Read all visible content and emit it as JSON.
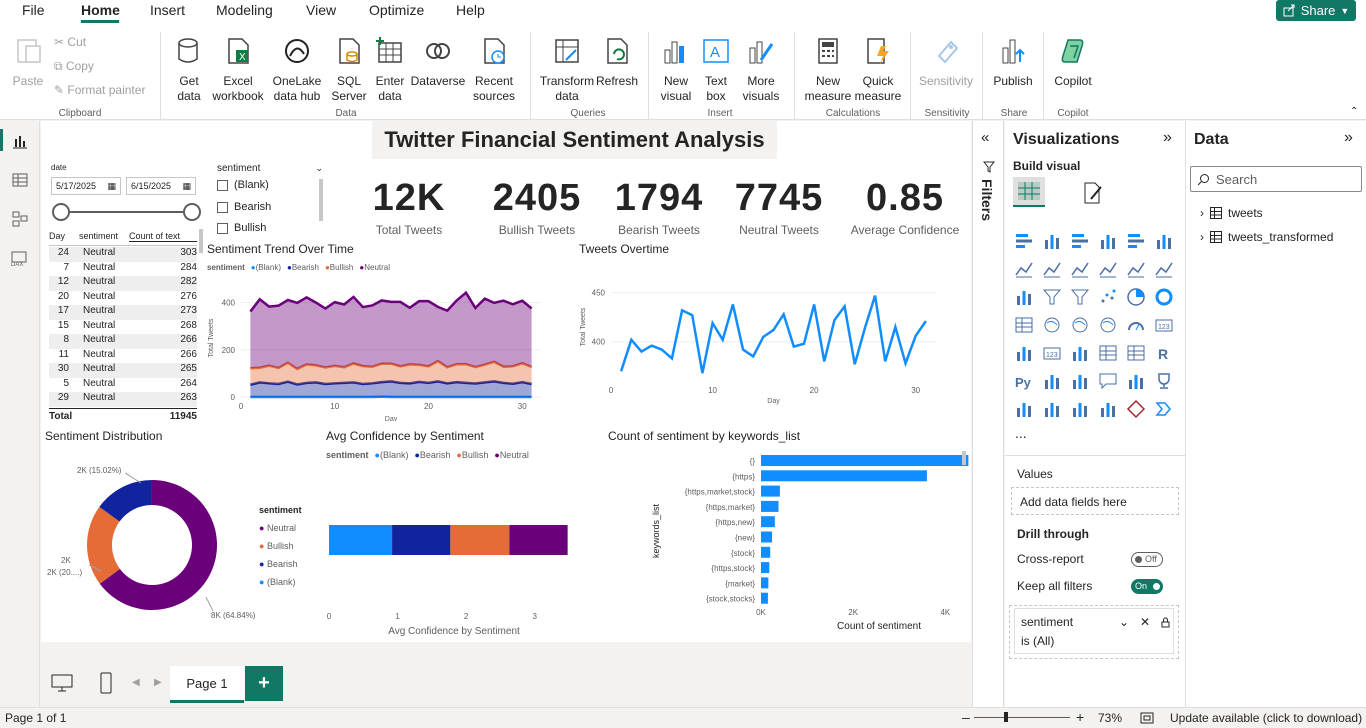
{
  "menu": {
    "items": [
      "File",
      "Home",
      "Insert",
      "Modeling",
      "View",
      "Optimize",
      "Help"
    ],
    "share_label": "Share"
  },
  "ribbon": {
    "clipboard": {
      "paste": "Paste",
      "cut": "Cut",
      "copy": "Copy",
      "format_painter": "Format painter",
      "group": "Clipboard"
    },
    "data": {
      "get_data": "Get data",
      "excel": "Excel workbook",
      "onelake": "OneLake data hub",
      "sql": "SQL Server",
      "enter": "Enter data",
      "dataverse": "Dataverse",
      "recent": "Recent sources",
      "group": "Data"
    },
    "queries": {
      "transform": "Transform data",
      "refresh": "Refresh",
      "group": "Queries"
    },
    "insert": {
      "new_visual": "New visual",
      "text_box": "Text box",
      "more_visuals": "More visuals",
      "group": "Insert"
    },
    "calculations": {
      "new_measure": "New measure",
      "quick_measure": "Quick measure",
      "group": "Calculations"
    },
    "sensitivity": {
      "label": "Sensitivity",
      "group": "Sensitivity"
    },
    "share": {
      "publish": "Publish",
      "group": "Share"
    },
    "copilot": {
      "label": "Copilot",
      "group": "Copilot"
    }
  },
  "report": {
    "title": "Twitter Financial Sentiment Analysis",
    "date_slicer": {
      "label": "date",
      "start": "5/17/2025",
      "end": "6/15/2025"
    },
    "sentiment_slicer": {
      "label": "sentiment",
      "options": [
        "(Blank)",
        "Bearish",
        "Bullish"
      ]
    },
    "cards": [
      {
        "value": "12K",
        "label": "Total Tweets"
      },
      {
        "value": "2405",
        "label": "Bullish Tweets"
      },
      {
        "value": "1794",
        "label": "Bearish Tweets"
      },
      {
        "value": "7745",
        "label": "Neutral Tweets"
      },
      {
        "value": "0.85",
        "label": "Average Confidence"
      }
    ],
    "table": {
      "headers": [
        "Day",
        "sentiment",
        "Count of text"
      ],
      "rows": [
        [
          "24",
          "Neutral",
          "303"
        ],
        [
          "7",
          "Neutral",
          "284"
        ],
        [
          "12",
          "Neutral",
          "282"
        ],
        [
          "20",
          "Neutral",
          "276"
        ],
        [
          "17",
          "Neutral",
          "273"
        ],
        [
          "15",
          "Neutral",
          "268"
        ],
        [
          "8",
          "Neutral",
          "266"
        ],
        [
          "11",
          "Neutral",
          "266"
        ],
        [
          "30",
          "Neutral",
          "265"
        ],
        [
          "5",
          "Neutral",
          "264"
        ],
        [
          "29",
          "Neutral",
          "263"
        ]
      ],
      "total_label": "Total",
      "total_value": "11945"
    },
    "legend_sentiment": {
      "title": "sentiment",
      "items": [
        "(Blank)",
        "Bearish",
        "Bullish",
        "Neutral"
      ]
    },
    "donut_legend": [
      "Neutral",
      "Bullish",
      "Bearish",
      "(Blank)"
    ]
  },
  "colors": {
    "blank": "#118dff",
    "bearish": "#12239e",
    "bullish": "#e66c37",
    "neutral": "#6b007b",
    "accent": "#117865"
  },
  "chart_data": [
    {
      "type": "area",
      "title": "Sentiment Trend Over Time",
      "xlabel": "Day",
      "ylabel": "Total Tweets",
      "xlim": [
        0,
        32
      ],
      "ylim": [
        0,
        500
      ],
      "xticks": [
        "0",
        "10",
        "20",
        "30"
      ],
      "yticks": [
        "0",
        "200",
        "400"
      ],
      "x": [
        1,
        2,
        3,
        4,
        5,
        6,
        7,
        8,
        9,
        10,
        11,
        12,
        13,
        14,
        15,
        16,
        17,
        18,
        19,
        20,
        21,
        22,
        23,
        24,
        25,
        26,
        27,
        28,
        29,
        30,
        31
      ],
      "series": [
        {
          "name": "(Blank)",
          "values": [
            0,
            0,
            0,
            0,
            0,
            0,
            0,
            0,
            0,
            0,
            0,
            0,
            0,
            0,
            1,
            0,
            0,
            0,
            0,
            0,
            0,
            0,
            0,
            0,
            0,
            0,
            0,
            0,
            0,
            0,
            0
          ]
        },
        {
          "name": "Bearish",
          "values": [
            52,
            62,
            58,
            55,
            65,
            53,
            60,
            62,
            55,
            58,
            60,
            62,
            55,
            58,
            62,
            66,
            60,
            58,
            64,
            60,
            66,
            58,
            63,
            60,
            57,
            62,
            66,
            60,
            56,
            63,
            55
          ]
        },
        {
          "name": "Bullish",
          "values": [
            70,
            62,
            75,
            68,
            80,
            66,
            78,
            72,
            70,
            74,
            66,
            80,
            76,
            70,
            78,
            75,
            70,
            80,
            72,
            70,
            86,
            68,
            76,
            79,
            70,
            75,
            83,
            68,
            74,
            80,
            72
          ]
        },
        {
          "name": "Neutral",
          "values": [
            240,
            290,
            250,
            264,
            266,
            280,
            284,
            266,
            250,
            270,
            266,
            282,
            250,
            260,
            268,
            262,
            273,
            240,
            270,
            276,
            230,
            240,
            270,
            303,
            250,
            280,
            250,
            280,
            263,
            265,
            248
          ]
        }
      ]
    },
    {
      "type": "line",
      "title": "Tweets Overtime",
      "xlabel": "Day",
      "ylabel": "Total Tweets",
      "xlim": [
        0,
        32
      ],
      "ylim": [
        360,
        470
      ],
      "xticks": [
        "0",
        "10",
        "20",
        "30"
      ],
      "yticks": [
        "400",
        "450"
      ],
      "x": [
        1,
        2,
        3,
        4,
        5,
        6,
        7,
        8,
        9,
        10,
        11,
        12,
        13,
        14,
        15,
        16,
        17,
        18,
        19,
        20,
        21,
        22,
        23,
        24,
        25,
        26,
        27,
        28,
        29,
        30,
        31
      ],
      "series": [
        {
          "name": "Total Tweets",
          "values": [
            370,
            402,
            390,
            396,
            392,
            383,
            432,
            427,
            368,
            419,
            402,
            438,
            392,
            385,
            405,
            412,
            428,
            395,
            398,
            438,
            380,
            422,
            436,
            377,
            414,
            447,
            380,
            415,
            378,
            406,
            421
          ]
        }
      ]
    },
    {
      "type": "pie",
      "title": "Sentiment Distribution",
      "categories": [
        "Neutral",
        "Bullish",
        "Bearish",
        "(Blank)"
      ],
      "values": [
        7745,
        2405,
        1794,
        1
      ],
      "data_labels": [
        "8K (64.84%)",
        "2K (20....)",
        "2K (15.02%)"
      ]
    },
    {
      "type": "bar",
      "title": "Avg Confidence by Sentiment",
      "xlabel": "Avg Confidence by Sentiment",
      "xlim": [
        0,
        3.5
      ],
      "xticks": [
        "0",
        "1",
        "2",
        "3"
      ],
      "series": [
        {
          "name": "(Blank)",
          "values": [
            0.92
          ]
        },
        {
          "name": "Bearish",
          "values": [
            0.85
          ]
        },
        {
          "name": "Bullish",
          "values": [
            0.86
          ]
        },
        {
          "name": "Neutral",
          "values": [
            0.85
          ]
        }
      ]
    },
    {
      "type": "bar",
      "title": "Count of sentiment by keywords_list",
      "xlabel": "Count of sentiment",
      "ylabel": "keywords_list",
      "xlim": [
        0,
        4600
      ],
      "xticks": [
        "0K",
        "2K",
        "4K"
      ],
      "categories": [
        "{}",
        "{https}",
        "{https,market,stock}",
        "{https,market}",
        "{https,new}",
        "{new}",
        "{stock}",
        "{https,stock}",
        "{market}",
        "{stock,stocks}"
      ],
      "values": [
        4500,
        3600,
        410,
        380,
        300,
        240,
        200,
        180,
        160,
        150
      ]
    }
  ],
  "filters": {
    "label": "Filters"
  },
  "viz_pane": {
    "title": "Visualizations",
    "build_visual": "Build visual",
    "values_label": "Values",
    "add_fields": "Add data fields here",
    "drill_through": "Drill through",
    "cross_report": "Cross-report",
    "cross_report_state": "Off",
    "keep_filters": "Keep all filters",
    "keep_filters_state": "On",
    "filter_card_field": "sentiment",
    "filter_card_value": "is (All)",
    "more": "..."
  },
  "data_pane": {
    "title": "Data",
    "search_placeholder": "Search",
    "tables": [
      "tweets",
      "tweets_transformed"
    ]
  },
  "page_tabs": {
    "tabs": [
      "Page 1"
    ]
  },
  "status": {
    "page": "Page 1 of 1",
    "zoom": "73%",
    "update": "Update available (click to download)"
  }
}
